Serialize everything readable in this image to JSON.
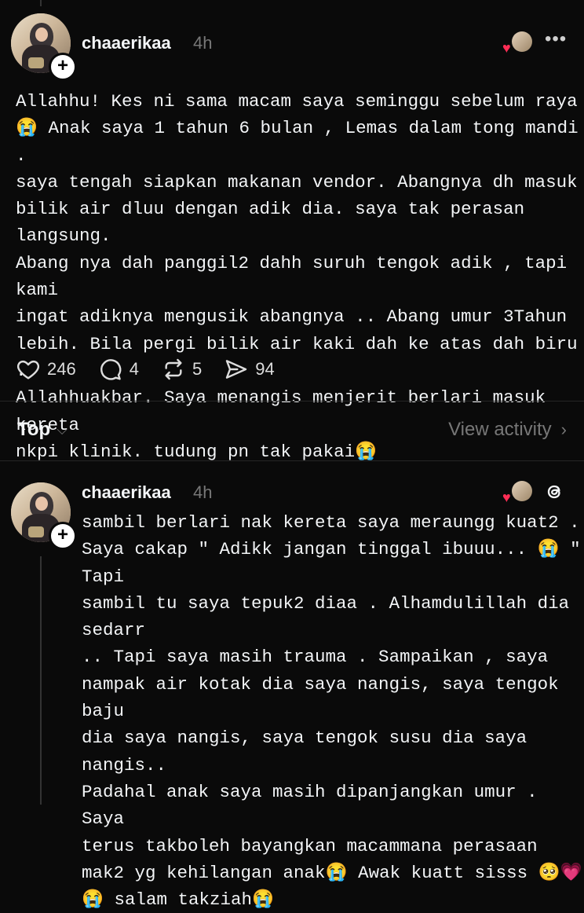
{
  "post1": {
    "username": "chaaerikaa",
    "time": "4h",
    "text": "Allahhu! Kes ni sama macam saya seminggu sebelum raya\n😭 Anak saya 1 tahun 6 bulan , Lemas dalam tong mandi .\nsaya tengah siapkan makanan vendor. Abangnya dh masuk\nbilik air dluu dengan adik dia. saya tak perasan langsung.\nAbang nya dah panggil2 dahh suruh tengok adik , tapi kami\ningat adiknya mengusik abangnya .. Abang umur 3Tahun\nlebih. Bila pergi bilik air kaki dah ke atas dah biru .\nAllahhuakbar. Saya menangis menjerit berlari masuk kereta\nnkpi klinik. tudung pn tak pakai😭",
    "likes": "246",
    "replies": "4",
    "reposts": "5",
    "shares": "94"
  },
  "filter": {
    "label": "Top",
    "activity_label": "View activity"
  },
  "post2": {
    "username": "chaaerikaa",
    "time": "4h",
    "text": "sambil berlari nak kereta saya meraungg kuat2 .\nSaya cakap \" Adikk jangan tinggal ibuuu... 😭 \" Tapi\nsambil tu saya tepuk2 diaa . Alhamdulillah dia sedarr\n.. Tapi saya masih trauma . Sampaikan , saya\nnampak air kotak dia saya nangis, saya tengok baju\ndia saya nangis, saya tengok susu dia saya nangis..\nPadahal anak saya masih dipanjangkan umur . Saya\nterus takboleh bayangkan macammana perasaan\nmak2 yg kehilangan anak😭 Awak kuatt sisss 🥺💗\n😭 salam takziah😭"
  },
  "icons": {
    "like": "heart-outline-icon",
    "reply": "comment-bubble-icon",
    "repost": "repost-arrows-icon",
    "share": "send-arrow-icon",
    "more": "more-horizontal-icon",
    "threads": "threads-logo-icon",
    "reaction": "liked-by-author-icon"
  },
  "colors": {
    "background": "#0a0a0a",
    "text": "#f3f5f7",
    "muted": "#777777",
    "heart": "#ff2d55"
  }
}
